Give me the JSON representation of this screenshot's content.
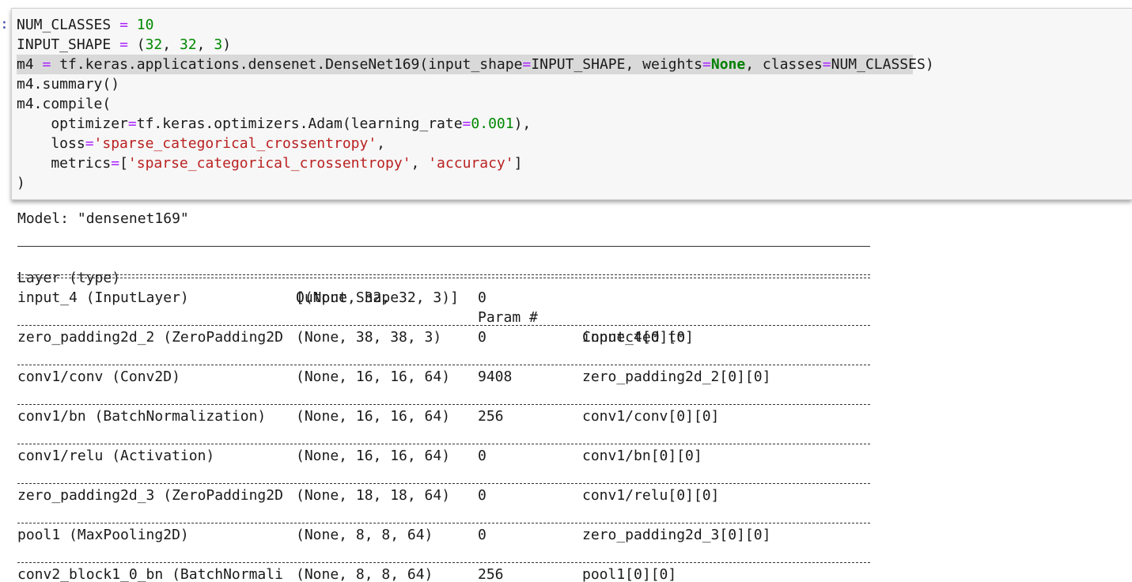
{
  "prompt": ":",
  "code": {
    "line1": {
      "a": "NUM_CLASSES",
      "op": "=",
      "num": "10"
    },
    "line2": {
      "a": "INPUT_SHAPE",
      "op": "=",
      "p1": "(",
      "n1": "32",
      "c1": ",",
      "n2": "32",
      "c2": ",",
      "n3": "3",
      "p2": ")"
    },
    "line3": {
      "a": "m4",
      "op": "=",
      "b": "tf.keras.applications.densenet.DenseNet169(input_shape",
      "op2": "=",
      "c": "INPUT_SHAPE, weights",
      "op3": "=",
      "kw": "None",
      "d": ", classes",
      "op4": "=",
      "e": "NUM_CLASSES)"
    },
    "line4": "m4.summary()",
    "line5": "m4.compile(",
    "line6": {
      "a": "    optimizer",
      "op": "=",
      "b": "tf.keras.optimizers.Adam(learning_rate",
      "op2": "=",
      "num": "0.001",
      "c": "),"
    },
    "line7": {
      "a": "    loss",
      "op": "=",
      "str": "'sparse_categorical_crossentropy'",
      "c": ","
    },
    "line8": {
      "a": "    metrics",
      "op": "=",
      "b": "[",
      "str1": "'sparse_categorical_crossentropy'",
      "c": ", ",
      "str2": "'accuracy'",
      "d": "]"
    },
    "line9": ")"
  },
  "output": {
    "model_line": "Model: \"densenet169\"",
    "headers": {
      "layer": "Layer (type)",
      "shape": "Output Shape",
      "params": "Param #",
      "connected": "Connected to"
    },
    "rows": [
      {
        "layer": "input_4 (InputLayer)",
        "shape": "[(None, 32, 32, 3)]",
        "params": "0",
        "connected": ""
      },
      {
        "layer": "zero_padding2d_2 (ZeroPadding2D",
        "shape": "(None, 38, 38, 3)",
        "params": "0",
        "connected": "input_4[0][0]"
      },
      {
        "layer": "conv1/conv (Conv2D)",
        "shape": "(None, 16, 16, 64)",
        "params": "9408",
        "connected": "zero_padding2d_2[0][0]"
      },
      {
        "layer": "conv1/bn (BatchNormalization)",
        "shape": "(None, 16, 16, 64)",
        "params": "256",
        "connected": "conv1/conv[0][0]"
      },
      {
        "layer": "conv1/relu (Activation)",
        "shape": "(None, 16, 16, 64)",
        "params": "0",
        "connected": "conv1/bn[0][0]"
      },
      {
        "layer": "zero_padding2d_3 (ZeroPadding2D",
        "shape": "(None, 18, 18, 64)",
        "params": "0",
        "connected": "conv1/relu[0][0]"
      },
      {
        "layer": "pool1 (MaxPooling2D)",
        "shape": "(None, 8, 8, 64)",
        "params": "0",
        "connected": "zero_padding2d_3[0][0]"
      },
      {
        "layer": "conv2_block1_0_bn (BatchNormali",
        "shape": "(None, 8, 8, 64)",
        "params": "256",
        "connected": "pool1[0][0]"
      }
    ]
  }
}
